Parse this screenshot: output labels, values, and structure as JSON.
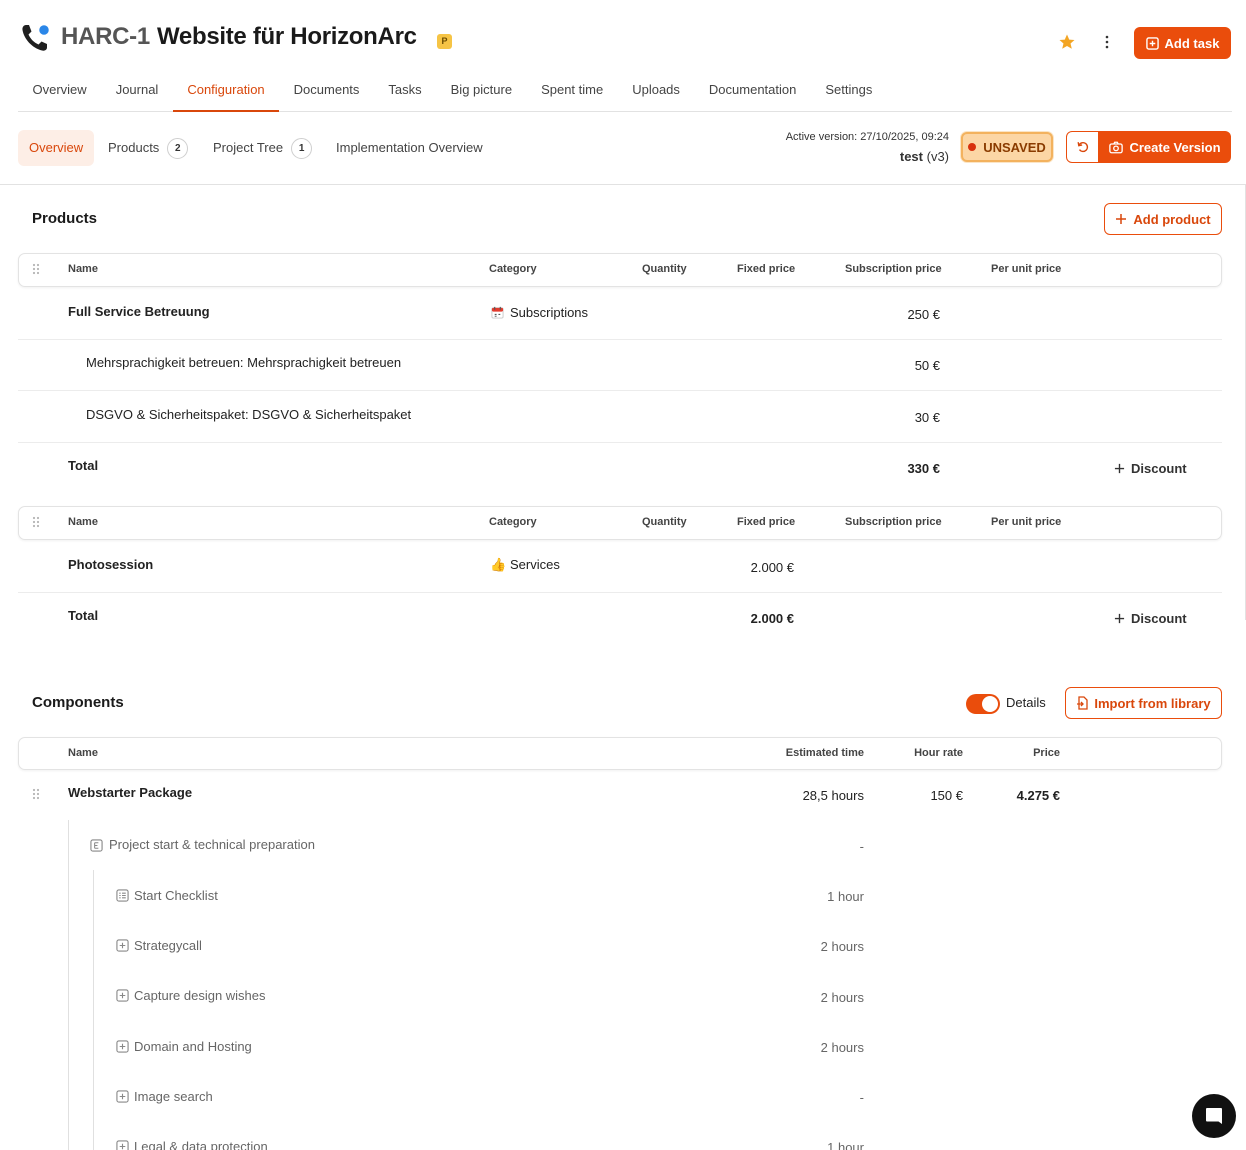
{
  "header": {
    "project_id": "HARC-1",
    "project_title": "Website für HorizonArc",
    "badge": "P",
    "add_task_label": "Add task"
  },
  "main_tabs": [
    "Overview",
    "Journal",
    "Configuration",
    "Documents",
    "Tasks",
    "Big picture",
    "Spent time",
    "Uploads",
    "Documentation",
    "Settings"
  ],
  "sub_tabs": {
    "overview": "Overview",
    "products": "Products",
    "products_count": "2",
    "project_tree": "Project Tree",
    "project_tree_count": "1",
    "implementation": "Implementation Overview"
  },
  "version": {
    "active_label": "Active version:",
    "active_date": "27/10/2025, 09:24",
    "name": "test",
    "version_tag": "(v3)",
    "status": "UNSAVED",
    "create_label": "Create Version"
  },
  "products": {
    "title": "Products",
    "add_label": "Add product",
    "columns": {
      "name": "Name",
      "category": "Category",
      "quantity": "Quantity",
      "fixed": "Fixed price",
      "subscription": "Subscription price",
      "per_unit": "Per unit price"
    },
    "groups": [
      {
        "rows": [
          {
            "name": "Full Service Betreuung",
            "category": "Subscriptions",
            "subscription": "250 €"
          },
          {
            "name": "Mehrsprachigkeit betreuen:  Mehrsprachigkeit betreuen",
            "subscription": "50 €"
          },
          {
            "name": "DSGVO & Sicherheitspaket:  DSGVO & Sicherheitspaket",
            "subscription": "30 €"
          }
        ],
        "total_label": "Total",
        "total_value": "330 €",
        "discount_label": "Discount"
      },
      {
        "rows": [
          {
            "name": "Photosession",
            "category": "Services",
            "fixed": "2.000 €"
          }
        ],
        "total_label": "Total",
        "total_value": "2.000 €",
        "discount_label": "Discount"
      }
    ]
  },
  "components": {
    "title": "Components",
    "details_label": "Details",
    "details_on": true,
    "import_label": "Import from library",
    "columns": {
      "name": "Name",
      "estimated": "Estimated time",
      "rate": "Hour rate",
      "price": "Price"
    },
    "package": {
      "name": "Webstarter Package",
      "time": "28,5 hours",
      "rate": "150 €",
      "price": "4.275 €"
    },
    "epic": {
      "name": "Project start & technical preparation",
      "time": "-"
    },
    "items": [
      {
        "name": "Start Checklist",
        "time": "1 hour",
        "icon": "checklist-icon"
      },
      {
        "name": "Strategycall",
        "time": "2 hours",
        "icon": "task-icon"
      },
      {
        "name": "Capture design wishes",
        "time": "2 hours",
        "icon": "task-icon"
      },
      {
        "name": "Domain and Hosting",
        "time": "2 hours",
        "icon": "task-icon"
      },
      {
        "name": "Image search",
        "time": "-",
        "icon": "task-icon"
      },
      {
        "name": "Legal & data protection",
        "time": "1 hour",
        "icon": "task-icon"
      }
    ]
  },
  "colors": {
    "accent": "#ea4d0c",
    "unsaved_bg": "#fcd6a5"
  }
}
